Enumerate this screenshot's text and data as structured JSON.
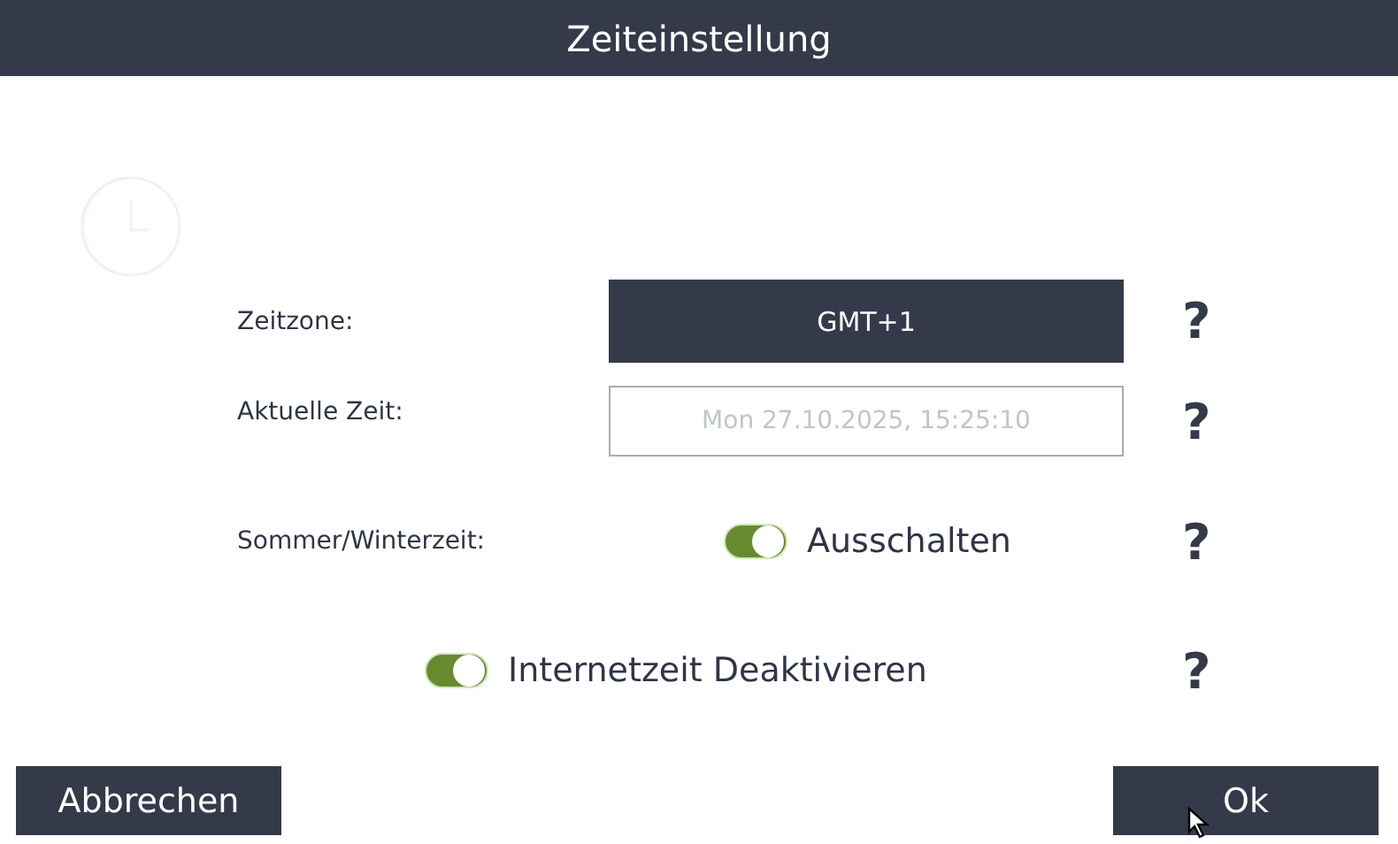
{
  "window": {
    "title": "Zeiteinstellung"
  },
  "rows": [
    {
      "kind": "select",
      "label": "Zeitzone:",
      "value": "GMT+1",
      "help": "?"
    },
    {
      "kind": "field",
      "label": "Aktuelle Zeit:",
      "placeholder": "Mon 27.10.2025, 15:25:10",
      "help": "?"
    },
    {
      "kind": "toggle",
      "label": "Sommer/Winterzeit:",
      "toggle_label": "Ausschalten",
      "on": true,
      "help": "?"
    },
    {
      "kind": "wide_toggle",
      "toggle_label": "Internetzeit Deaktivieren",
      "on": true,
      "help": "?"
    }
  ],
  "buttons": [
    "Abbrechen",
    "Ok"
  ]
}
